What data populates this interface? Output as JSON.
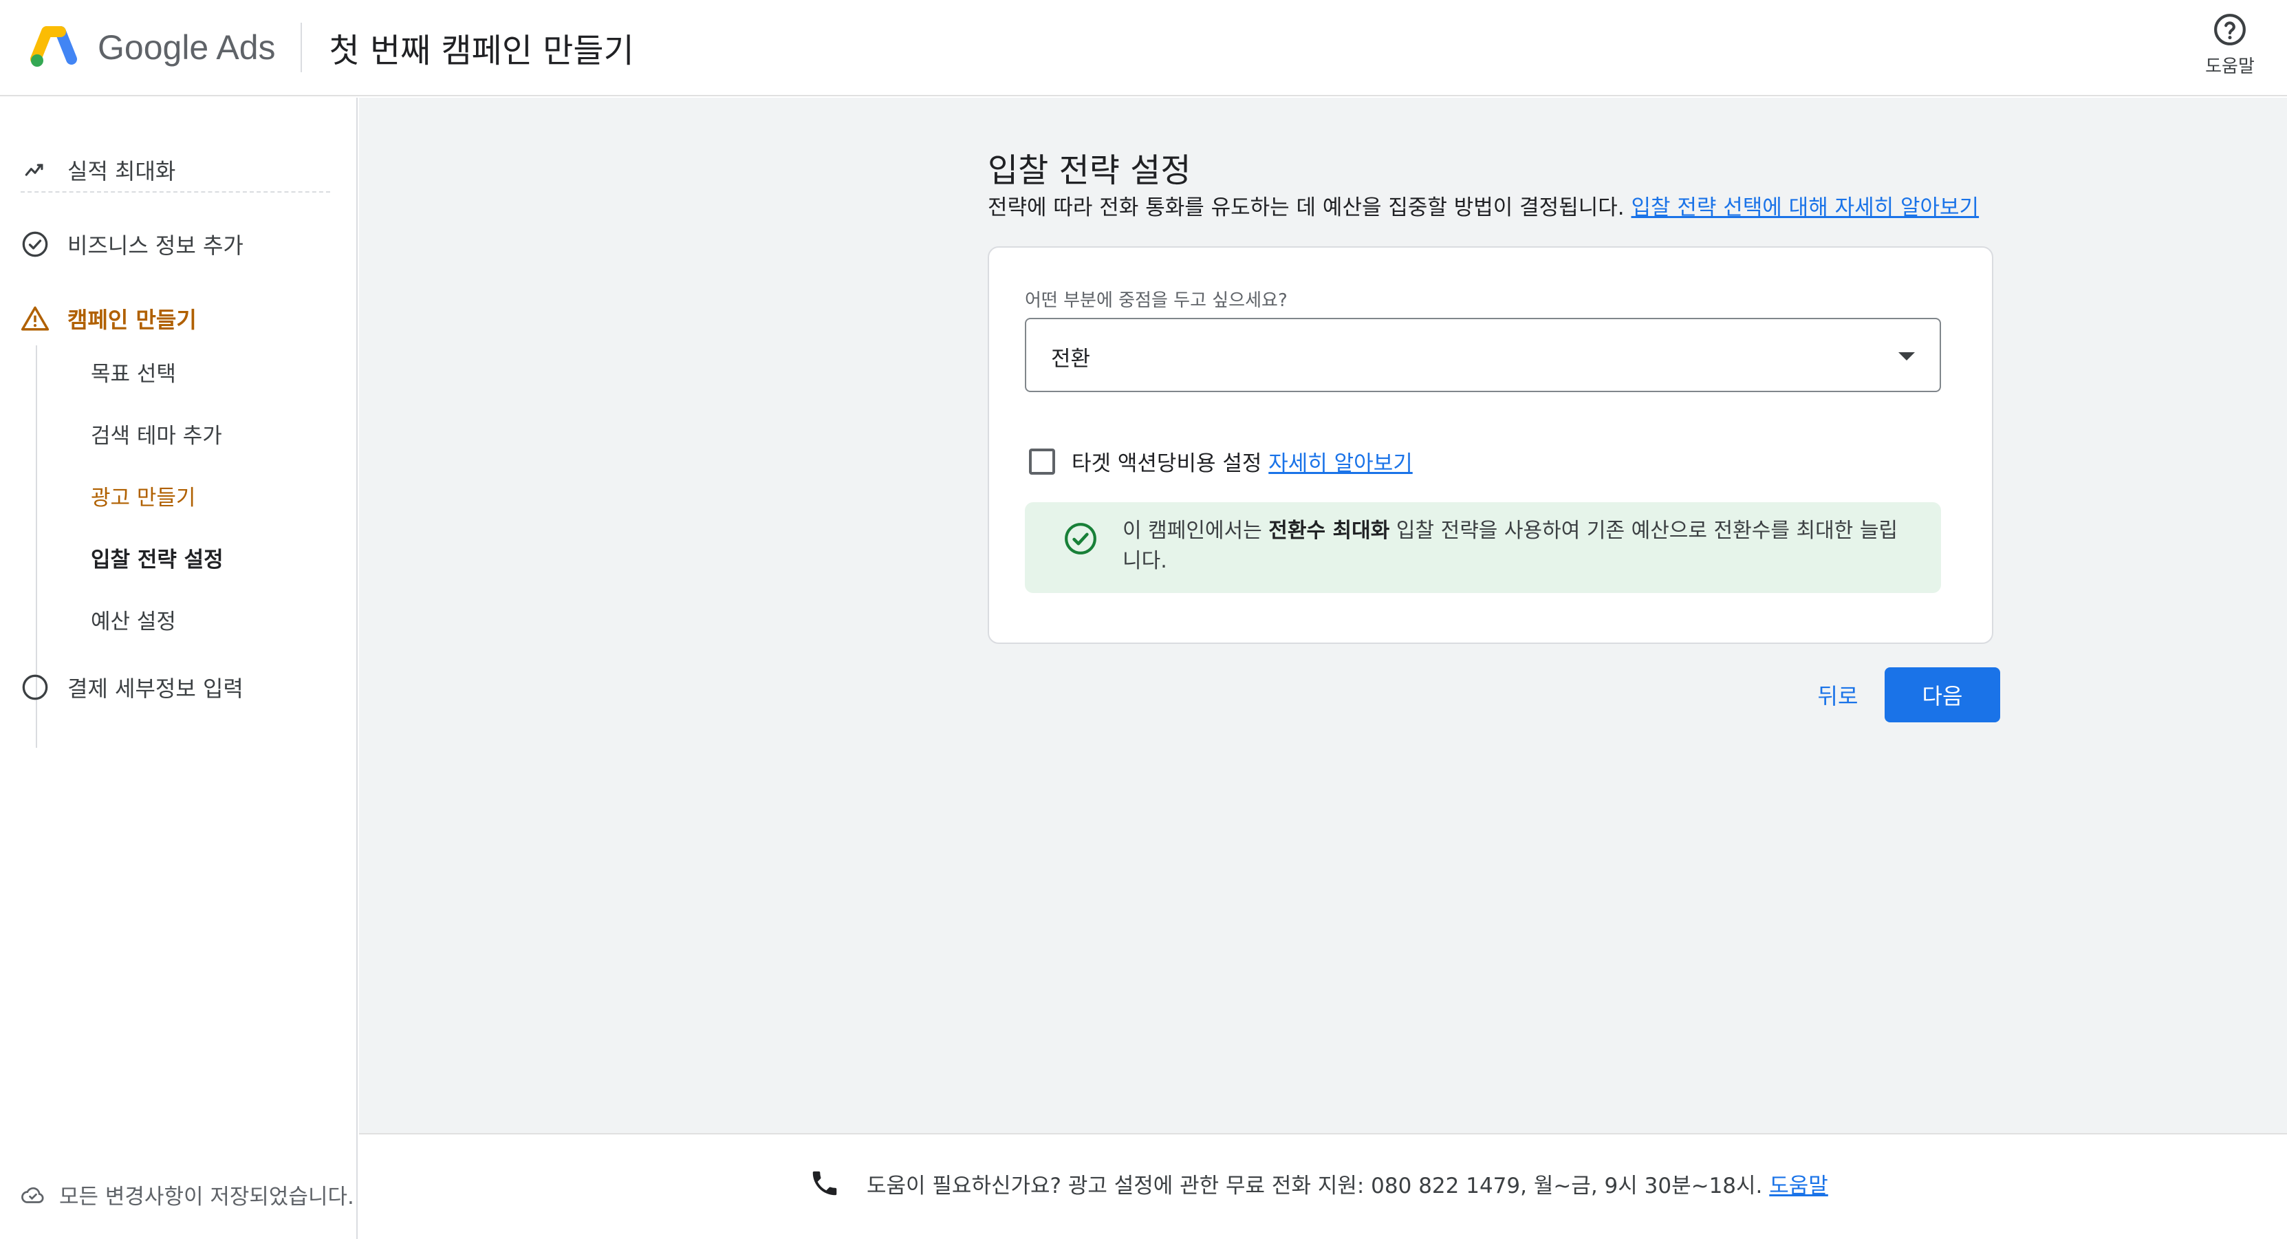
{
  "header": {
    "brand": "Google Ads",
    "title": "첫 번째 캠페인 만들기",
    "help_label": "도움말"
  },
  "sidebar": {
    "steps": [
      {
        "label": "실적 최대화",
        "icon": "trending-icon",
        "state": "done"
      },
      {
        "label": "비즈니스 정보 추가",
        "icon": "check-circle-icon",
        "state": "done"
      },
      {
        "label": "캠페인 만들기",
        "icon": "warning-icon",
        "state": "active"
      },
      {
        "label": "결제 세부정보 입력",
        "icon": "empty-circle-icon",
        "state": "todo"
      }
    ],
    "substeps": [
      {
        "label": "목표 선택",
        "state": "done"
      },
      {
        "label": "검색 테마 추가",
        "state": "done"
      },
      {
        "label": "광고 만들기",
        "state": "warning"
      },
      {
        "label": "입찰 전략 설정",
        "state": "current"
      },
      {
        "label": "예산 설정",
        "state": "todo"
      }
    ],
    "save_status": "모든 변경사항이 저장되었습니다."
  },
  "main": {
    "title": "입찰 전략 설정",
    "description": "전략에 따라 전화 통화를 유도하는 데 예산을 집중할 방법이 결정됩니다.",
    "description_link": "입찰 전략 선택에 대해 자세히 알아보기",
    "focus_label": "어떤 부분에 중점을 두고 싶으세요?",
    "focus_value": "전환",
    "checkbox_label": "타겟 액션당비용 설정",
    "checkbox_link": "자세히 알아보기",
    "checkbox_checked": false,
    "info_prefix": "이 캠페인에서는 ",
    "info_bold": "전환수 최대화",
    "info_suffix": " 입찰 전략을 사용하여 기존 예산으로 전환수를 최대한 늘립니다.",
    "back_label": "뒤로",
    "next_label": "다음"
  },
  "footer": {
    "text": "도움이 필요하신가요? 광고 설정에 관한 무료 전화 지원: 080 822 1479, 월~금, 9시 30분~18시.",
    "link": "도움말"
  },
  "colors": {
    "accent": "#1a73e8",
    "warning": "#b06000",
    "success": "#188038",
    "success_bg": "#e6f4ea",
    "main_bg": "#f1f3f4"
  }
}
